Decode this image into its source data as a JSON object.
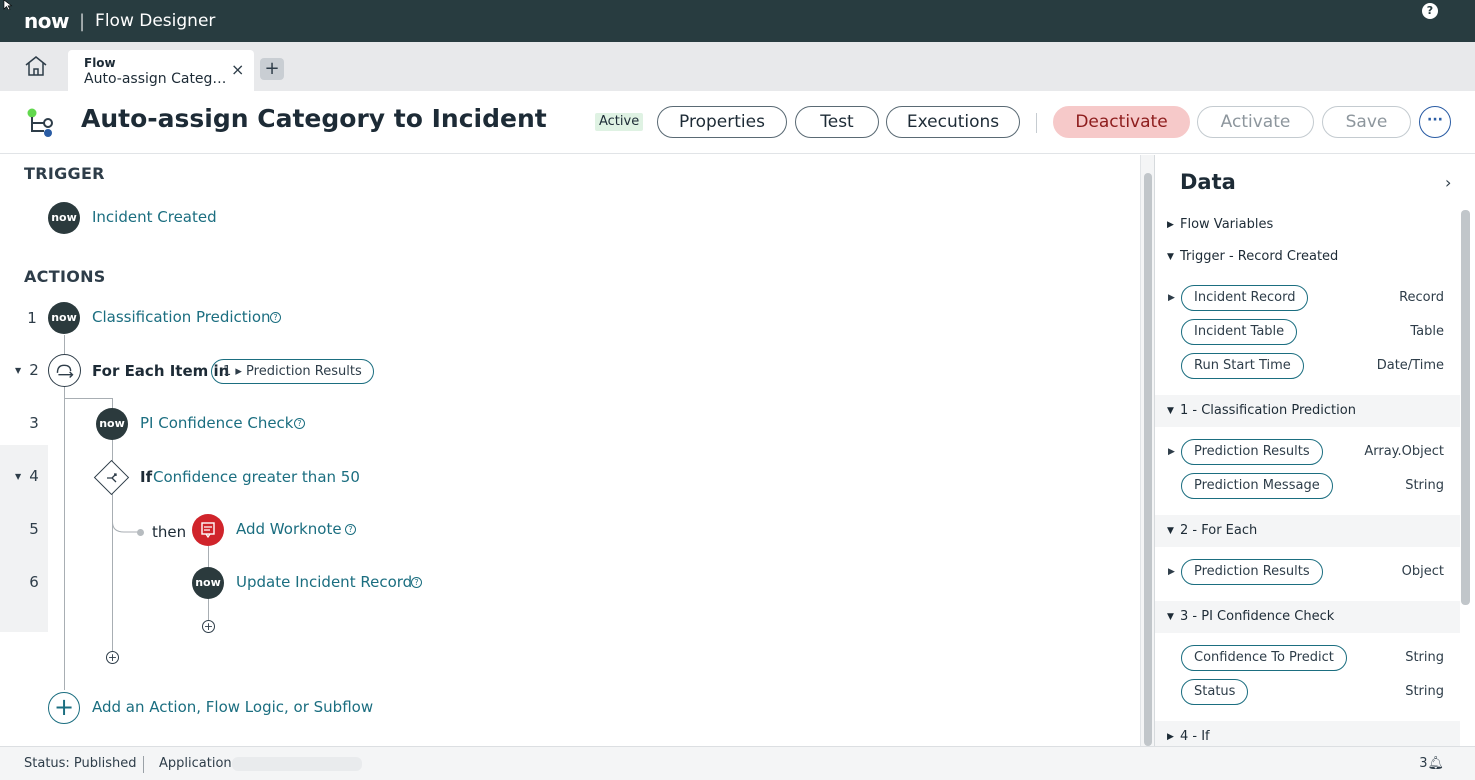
{
  "topbar": {
    "logo": "now",
    "app_title": "Flow Designer",
    "help": "?"
  },
  "tabbar": {
    "tab_type": "Flow",
    "tab_name": "Auto-assign Categ…",
    "close": "×",
    "add": "+"
  },
  "header": {
    "title": "Auto-assign Category to Incident",
    "status": "Active",
    "buttons": {
      "properties": "Properties",
      "test": "Test",
      "executions": "Executions",
      "deactivate": "Deactivate",
      "activate": "Activate",
      "save": "Save",
      "more": "···"
    }
  },
  "canvas": {
    "trigger_label": "TRIGGER",
    "trigger": {
      "badge": "now",
      "name": "Incident Created"
    },
    "actions_label": "ACTIONS",
    "steps": [
      {
        "num": "1",
        "badge": "now",
        "name": "Classification Prediction"
      },
      {
        "num": "2",
        "prefix": "For Each Item in",
        "pill": "1 ▸ Prediction Results"
      },
      {
        "num": "3",
        "badge": "now",
        "name": "PI Confidence Check"
      },
      {
        "num": "4",
        "prefix": "If",
        "name": "Confidence greater than 50"
      },
      {
        "num": "5",
        "prefix": "then",
        "name": "Add Worknote"
      },
      {
        "num": "6",
        "badge": "now",
        "name": "Update Incident Record"
      }
    ],
    "add_action": "Add an Action, Flow Logic, or Subflow"
  },
  "data_panel": {
    "title": "Data",
    "groups": [
      {
        "label": "Flow Variables",
        "expanded": false,
        "items": []
      },
      {
        "label": "Trigger - Record Created",
        "expanded": true,
        "items": [
          {
            "name": "Incident Record",
            "type": "Record",
            "expandable": true
          },
          {
            "name": "Incident Table",
            "type": "Table",
            "expandable": false
          },
          {
            "name": "Run Start Time",
            "type": "Date/Time",
            "expandable": false
          }
        ]
      },
      {
        "label": "1 - Classification Prediction",
        "expanded": true,
        "items": [
          {
            "name": "Prediction Results",
            "type": "Array.Object",
            "expandable": true
          },
          {
            "name": "Prediction Message",
            "type": "String",
            "expandable": false
          }
        ]
      },
      {
        "label": "2 - For Each",
        "expanded": true,
        "items": [
          {
            "name": "Prediction Results",
            "type": "Object",
            "expandable": true
          }
        ]
      },
      {
        "label": "3 - PI Confidence Check",
        "expanded": true,
        "items": [
          {
            "name": "Confidence To Predict",
            "type": "String",
            "expandable": false
          },
          {
            "name": "Status",
            "type": "String",
            "expandable": false
          }
        ]
      },
      {
        "label": "4 - If",
        "expanded": false,
        "items": []
      }
    ]
  },
  "footer": {
    "status": "Status: Published",
    "application": "Application:",
    "notifications": "3"
  },
  "colors": {
    "topbar": "#283c40",
    "link": "#1b6e80",
    "deactivate_bg": "#f6c9c9",
    "now_badge": "#2b3a3d",
    "worknote_badge": "#d0242b"
  }
}
